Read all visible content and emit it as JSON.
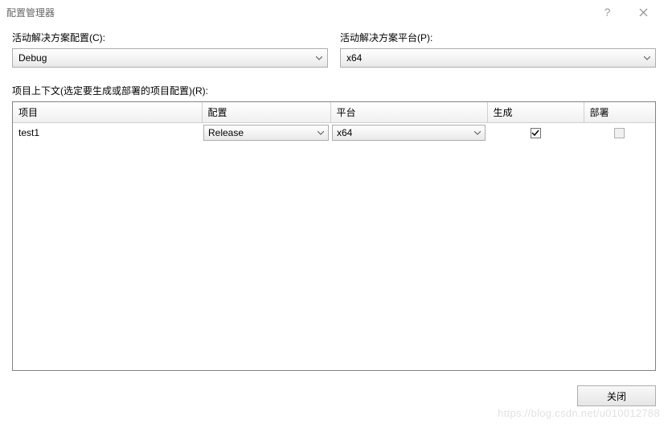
{
  "window": {
    "title": "配置管理器"
  },
  "top": {
    "config_label": "活动解决方案配置(C):",
    "config_value": "Debug",
    "platform_label": "活动解决方案平台(P):",
    "platform_value": "x64"
  },
  "context_label": "项目上下文(选定要生成或部署的项目配置)(R):",
  "table": {
    "headers": {
      "project": "项目",
      "config": "配置",
      "platform": "平台",
      "build": "生成",
      "deploy": "部署"
    },
    "rows": [
      {
        "project": "test1",
        "config": "Release",
        "platform": "x64",
        "build": true,
        "deploy": false,
        "deploy_disabled": true
      }
    ]
  },
  "footer": {
    "close_label": "关闭"
  },
  "watermark": "https://blog.csdn.net/u010012788"
}
